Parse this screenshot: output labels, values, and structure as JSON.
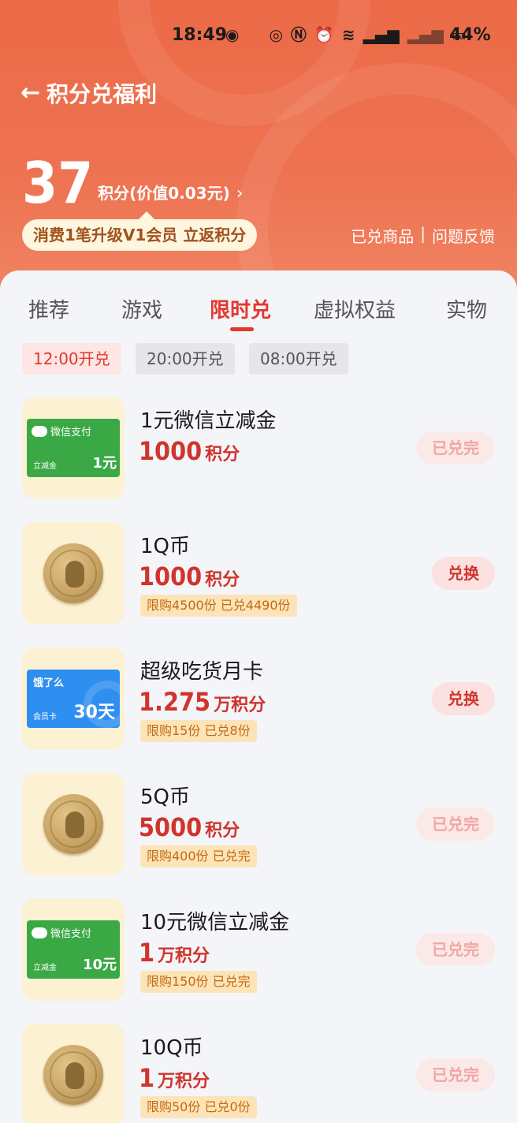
{
  "status": {
    "time": "18:49",
    "battery": "44%"
  },
  "header": {
    "back_icon": "back-arrow-icon",
    "title": "积分兑福利",
    "points": "37",
    "points_label": "积分(价值0.03元)",
    "chevron": "›",
    "upgrade_tip": "消费1笔升级V1会员 立返积分",
    "link_exchanged": "已兑商品",
    "link_divider": "|",
    "link_feedback": "问题反馈"
  },
  "tabs": [
    "推荐",
    "游戏",
    "限时兑",
    "虚拟权益",
    "实物"
  ],
  "active_tab": "限时兑",
  "time_slots": [
    "12:00开兑",
    "20:00开兑",
    "08:00开兑"
  ],
  "items": [
    {
      "title": "1元微信立减金",
      "price": "1000",
      "unit": "积分",
      "limit": "",
      "button": "已兑完",
      "thumb": "wechat",
      "card_brand": "微信支付",
      "card_sub": "立减金",
      "card_amount": "1元"
    },
    {
      "title": "1Q币",
      "price": "1000",
      "unit": "积分",
      "limit": "限购4500份 已兑4490份",
      "button": "兑换",
      "thumb": "qcoin"
    },
    {
      "title": "超级吃货月卡",
      "price": "1.275",
      "unit": "万积分",
      "limit": "限购15份 已兑8份",
      "button": "兑换",
      "thumb": "eleme",
      "card_brand": "饿了么",
      "card_sub": "会员卡",
      "card_amount": "30天"
    },
    {
      "title": "5Q币",
      "price": "5000",
      "unit": "积分",
      "limit": "限购400份 已兑完",
      "button": "已兑完",
      "thumb": "qcoin"
    },
    {
      "title": "10元微信立减金",
      "price": "1",
      "unit": "万积分",
      "limit": "限购150份 已兑完",
      "button": "已兑完",
      "thumb": "wechat",
      "card_brand": "微信支付",
      "card_sub": "立减金",
      "card_amount": "10元"
    },
    {
      "title": "10Q币",
      "price": "1",
      "unit": "万积分",
      "limit": "限购50份 已兑0份",
      "button": "已兑完",
      "thumb": "qcoin"
    }
  ]
}
